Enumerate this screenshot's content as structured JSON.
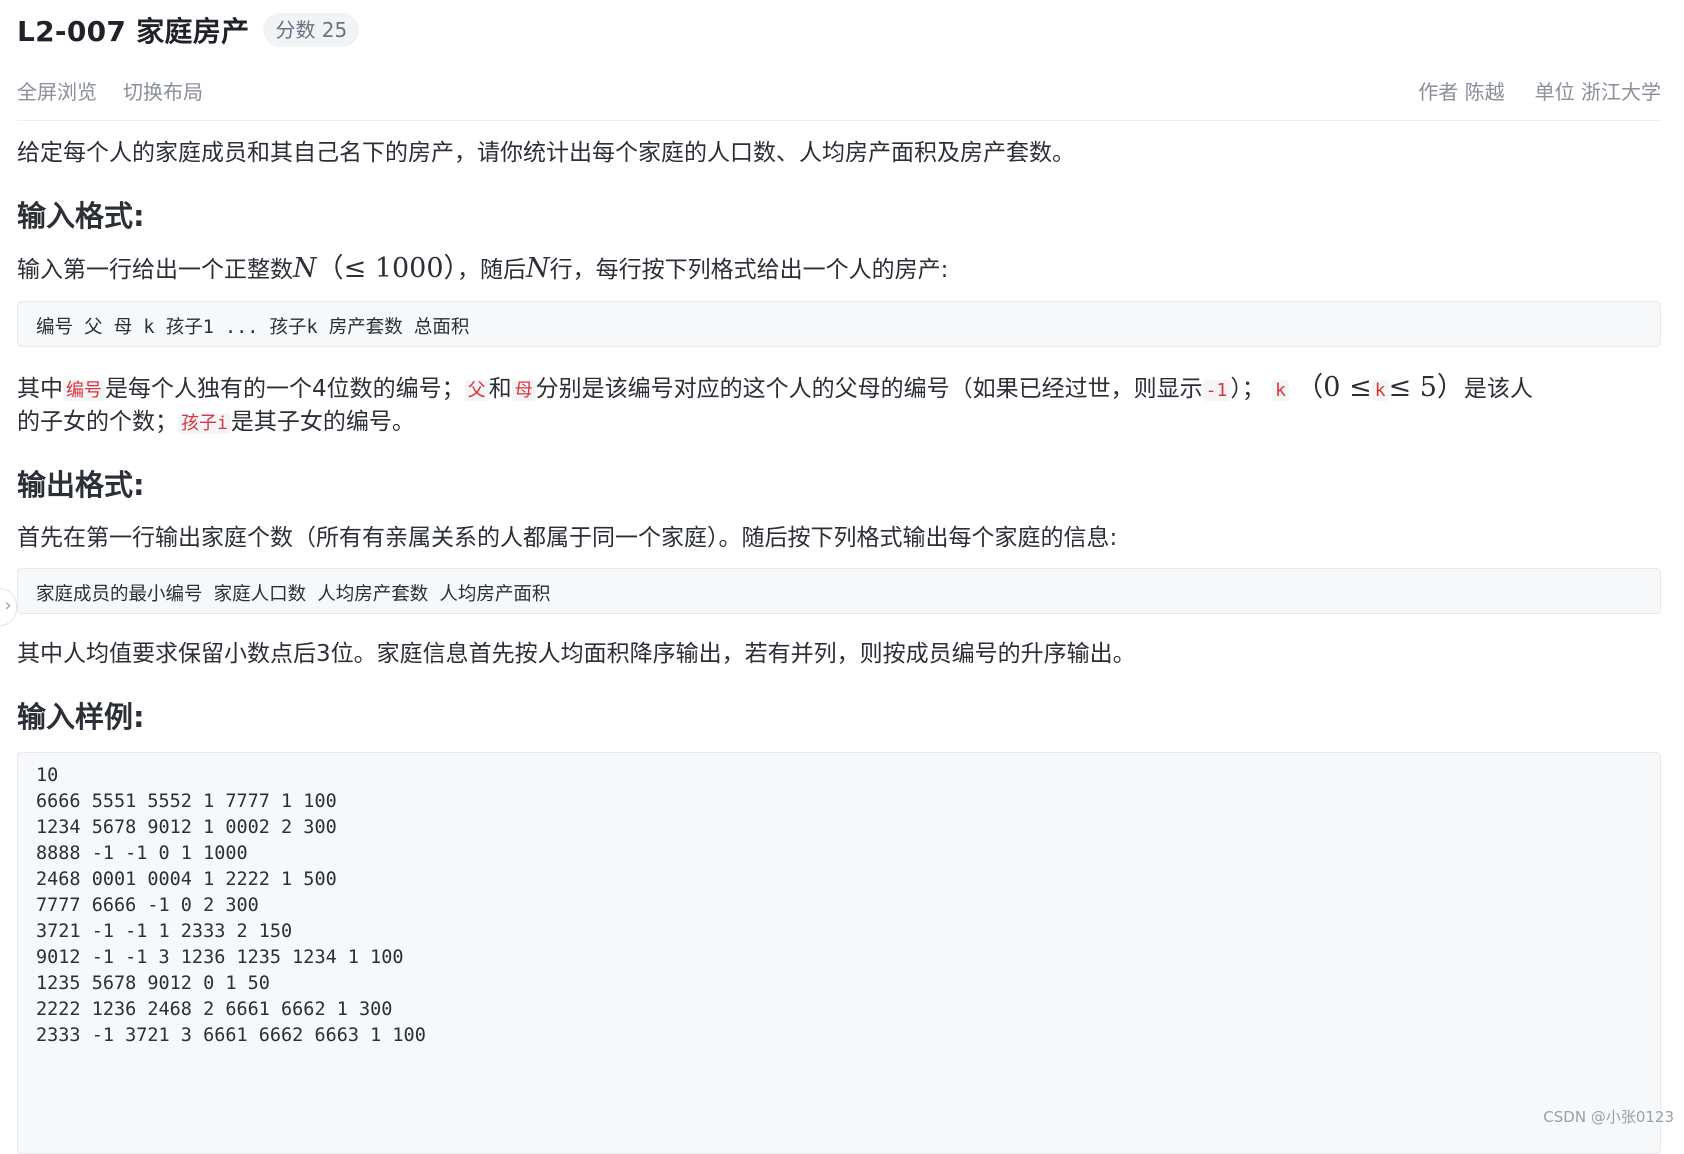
{
  "problem": {
    "id_title": "L2-007 家庭房产",
    "score": "分数 25"
  },
  "toolbar": {
    "fullscreen": "全屏浏览",
    "switch_layout": "切换布局",
    "author": "作者 陈越",
    "unit": "单位 浙江大学"
  },
  "description": "给定每个人的家庭成员和其自己名下的房产，请你统计出每个家庭的人口数、人均房产面积及房产套数。",
  "input_format": {
    "heading": "输入格式:",
    "line1_a": "输入第一行给出一个正整数",
    "var_N": "N",
    "paren": "（≤ 1000）",
    "line1_b": "，随后",
    "line1_c": "行，每行按下列格式给出一个人的房产:",
    "code": "编号 父 母 k 孩子1 ... 孩子k 房产套数 总面积",
    "p2_a": "其中",
    "code_id": "编号",
    "p2_b": "是每个人独有的一个4位数的编号；",
    "code_father": "父",
    "p2_c": "和",
    "code_mother": "母",
    "p2_d": "分别是该编号对应的这个人的父母的编号（如果已经过世，则显示",
    "code_neg1": "-1",
    "p2_e": "）；",
    "code_k": "k",
    "p2_f_a": "（0 ≤",
    "p2_f_b": "≤ 5）",
    "p2_g": "是该人",
    "p3_a": "的子女的个数；",
    "code_child": "孩子i",
    "p3_b": "是其子女的编号。"
  },
  "output_format": {
    "heading": "输出格式:",
    "line1": "首先在第一行输出家庭个数（所有有亲属关系的人都属于同一个家庭）。随后按下列格式输出每个家庭的信息:",
    "code": "家庭成员的最小编号 家庭人口数 人均房产套数 人均房产面积",
    "line2": "其中人均值要求保留小数点后3位。家庭信息首先按人均面积降序输出，若有并列，则按成员编号的升序输出。"
  },
  "sample_input": {
    "heading": "输入样例:",
    "lines": [
      "10",
      "6666 5551 5552 1 7777 1 100",
      "1234 5678 9012 1 0002 2 300",
      "8888 -1 -1 0 1 1000",
      "2468 0001 0004 1 2222 1 500",
      "7777 6666 -1 0 2 300",
      "3721 -1 -1 1 2333 2 150",
      "9012 -1 -1 3 1236 1235 1234 1 100",
      "1235 5678 9012 0 1 50",
      "2222 1236 2468 2 6661 6662 1 300",
      "2333 -1 3721 3 6661 6662 6663 1 100"
    ]
  },
  "watermark": "CSDN @小张0123",
  "side_tab_icon": "chevron-right-icon"
}
